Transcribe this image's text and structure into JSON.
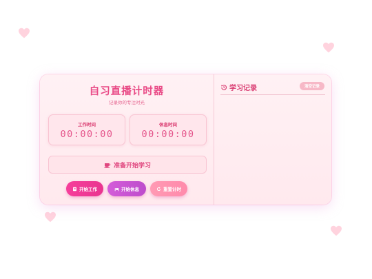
{
  "app": {
    "title": "自习直播计时器",
    "subtitle": "记录你的专注时光"
  },
  "timers": {
    "work": {
      "label": "工作时间",
      "value": "00:00:00"
    },
    "rest": {
      "label": "休息时间",
      "value": "00:00:00"
    }
  },
  "status": {
    "text": "准备开始学习",
    "icon": "cup-icon"
  },
  "buttons": {
    "start_work": "开始工作",
    "start_rest": "开始休息",
    "reset": "重置计时"
  },
  "records": {
    "title": "学习记录",
    "clear_label": "清空记录",
    "items": []
  },
  "colors": {
    "accent": "#e94a86",
    "work_button": "#f63e9b",
    "rest_button": "#c955d3",
    "reset_button": "#ff92b0",
    "card_bg": "#fff1f4",
    "heart": "#ffd1dc"
  }
}
